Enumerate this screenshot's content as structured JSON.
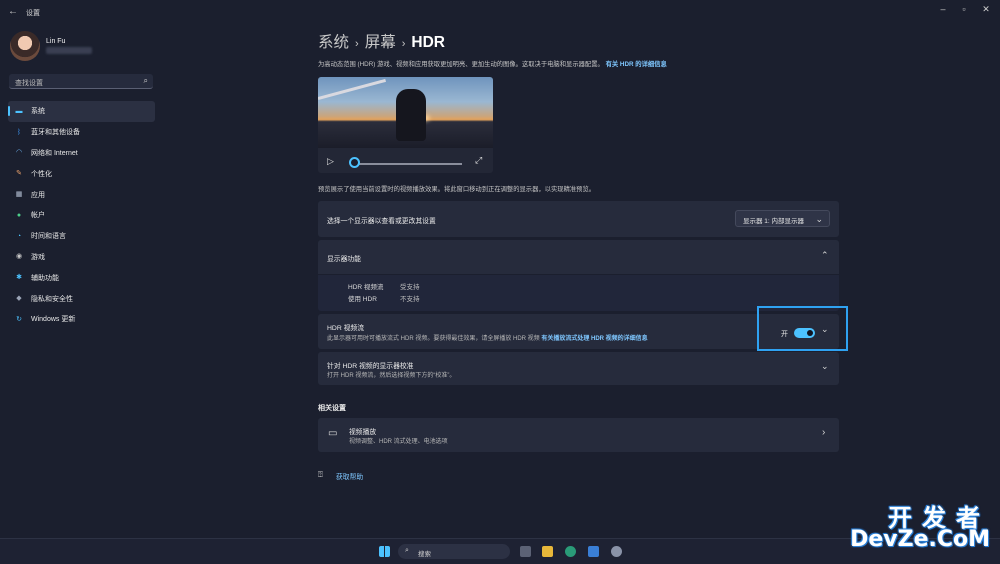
{
  "window": {
    "title": "设置"
  },
  "user": {
    "name": "Lin Fu"
  },
  "search": {
    "placeholder": "查找设置"
  },
  "sidebar": {
    "items": [
      {
        "label": "系统",
        "icon": "monitor-icon",
        "color": "#4cc2ff",
        "selected": true
      },
      {
        "label": "蓝牙和其他设备",
        "icon": "bluetooth-icon",
        "color": "#3a8ee6"
      },
      {
        "label": "网络和 Internet",
        "icon": "wifi-icon",
        "color": "#6fb3f0"
      },
      {
        "label": "个性化",
        "icon": "brush-icon",
        "color": "#e8a06a"
      },
      {
        "label": "应用",
        "icon": "apps-icon",
        "color": "#b8c4d8"
      },
      {
        "label": "帐户",
        "icon": "person-icon",
        "color": "#4ccf8a"
      },
      {
        "label": "时间和语言",
        "icon": "globe-clock-icon",
        "color": "#4cc2ff"
      },
      {
        "label": "游戏",
        "icon": "gamepad-icon",
        "color": "#c8c8c8"
      },
      {
        "label": "辅助功能",
        "icon": "accessibility-icon",
        "color": "#4cc2ff"
      },
      {
        "label": "隐私和安全性",
        "icon": "shield-icon",
        "color": "#9aa3b5"
      },
      {
        "label": "Windows 更新",
        "icon": "update-icon",
        "color": "#4cc2ff"
      }
    ]
  },
  "breadcrumb": {
    "level1": "系统",
    "level2": "屏幕",
    "current": "HDR"
  },
  "intro": {
    "text": "为高动态范围 (HDR) 游戏、视频和应用获取更加明亮、更加生动的图像。这取决于电脑和显示器配置。",
    "link": "有关 HDR 的详细信息"
  },
  "preview": {
    "description": "预览展示了使用当前设置时的视频播放效果。将此窗口移动到正在调整的显示器，以实现精准预览。"
  },
  "display_select": {
    "label": "选择一个显示器以查看或更改其设置",
    "value": "显示器 1: 内部显示器"
  },
  "capabilities": {
    "title": "显示器功能",
    "rows": [
      {
        "label": "HDR 视频流",
        "value": "受支持"
      },
      {
        "label": "使用 HDR",
        "value": "不支持"
      }
    ]
  },
  "hdr_stream": {
    "title": "HDR 视频流",
    "subtitle": "此显示器可用时可播放流式 HDR 视频。要获得最佳效果，请全屏播放 HDR 视频",
    "link": "有关播放流式处理 HDR 视频的详细信息",
    "toggle_label": "开",
    "toggle_on": true
  },
  "calibration": {
    "title": "针对 HDR 视频的显示器校准",
    "subtitle": "打开 HDR 视频流，然后选择视频下方的“校准”。"
  },
  "related": {
    "title": "相关设置",
    "video_playback": {
      "title": "视频播放",
      "subtitle": "视频调整、HDR 流式处理、电池选项"
    }
  },
  "help": {
    "label": "获取帮助"
  },
  "taskbar": {
    "search_label": "搜索"
  },
  "watermark": {
    "line1": "开发者",
    "line2": "DevZe.CoM"
  }
}
